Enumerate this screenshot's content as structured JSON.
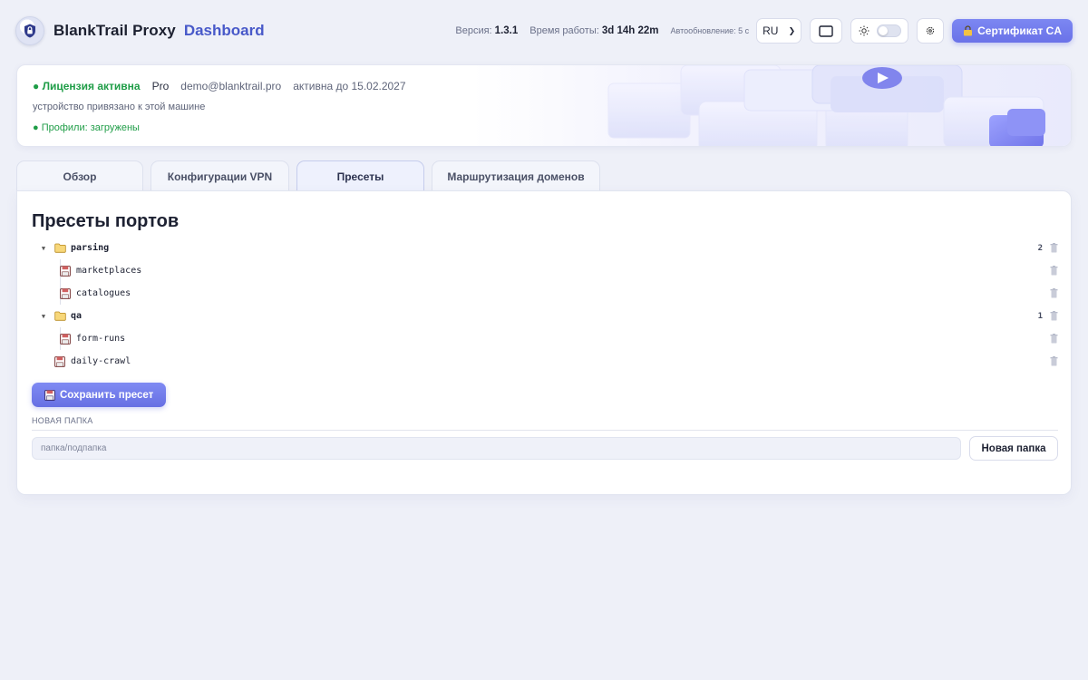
{
  "header": {
    "brand": "BlankTrail Proxy",
    "brand_accent": "Dashboard",
    "version_label": "Версия:",
    "version_value": "1.3.1",
    "uptime_label": "Время работы:",
    "uptime_value": "3d 14h 22m",
    "autorefresh": "Автообновление: 5 с",
    "language": "RU",
    "ca_button": "Сертификат CA"
  },
  "license": {
    "status": "● Лицензия активна",
    "plan": "Pro",
    "email": "demo@blanktrail.pro",
    "valid_until": "активна до 15.02.2027",
    "device_note": "устройство привязано к этой машине",
    "profiles_status": "● Профили: загружены"
  },
  "tabs": [
    {
      "label": "Обзор",
      "active": false
    },
    {
      "label": "Конфигурации VPN",
      "active": false
    },
    {
      "label": "Пресеты",
      "active": true
    },
    {
      "label": "Маршрутизация доменов",
      "active": false
    }
  ],
  "presets": {
    "title": "Пресеты портов",
    "tree": [
      {
        "type": "folder",
        "name": "parsing",
        "count": "2",
        "children": [
          "marketplaces",
          "catalogues"
        ]
      },
      {
        "type": "folder",
        "name": "qa",
        "count": "1",
        "children": [
          "form-runs"
        ]
      },
      {
        "type": "preset",
        "name": "daily-crawl"
      }
    ],
    "save_button": "Сохранить пресет",
    "new_folder_label": "НОВАЯ ПАПКА",
    "new_folder_placeholder": "папка/подпапка",
    "new_folder_button": "Новая папка"
  }
}
